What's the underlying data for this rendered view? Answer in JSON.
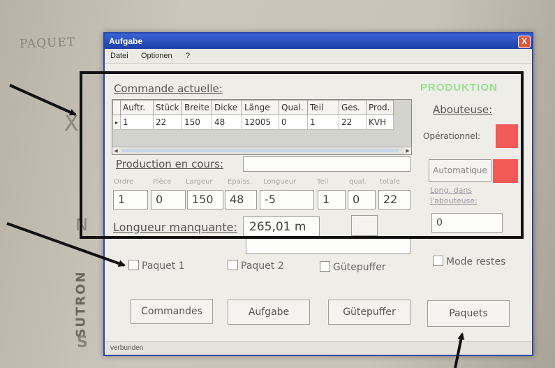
{
  "window": {
    "title": "Aufgabe",
    "close": "X",
    "status": "verbunden"
  },
  "menu": [
    "Datei",
    "Optionen",
    "?"
  ],
  "commande": {
    "title": "Commande actuelle:",
    "columns": [
      "Auftr.",
      "Stück",
      "Breite",
      "Dicke",
      "Länge",
      "Qual.",
      "Teil",
      "Ges.",
      "Prod."
    ],
    "row_marker": "▸",
    "rows": [
      [
        "1",
        "22",
        "150",
        "48",
        "12005",
        "0",
        "1",
        "22",
        "KVH"
      ]
    ]
  },
  "production": {
    "title": "Production en cours:",
    "labels": [
      "Ordre",
      "Pièce",
      "Largeur",
      "Epaiss.",
      "Longueur",
      "Teil",
      "qual.",
      "totale"
    ],
    "values": [
      "1",
      "0",
      "150",
      "48",
      "-5",
      "1",
      "0",
      "22"
    ]
  },
  "longueur_manquante": {
    "label": "Longueur manquante:",
    "value": "265,01 m"
  },
  "abouteuse": {
    "title": "Abouteuse:",
    "operationnel": "Opérationnel:",
    "automatique": "Automatique",
    "long_dans_line1": "Long. dans",
    "long_dans_line2": "l'abouteuse:",
    "long_value": "0",
    "indicator_color": "#f25a58",
    "banner": "PRODUKTION"
  },
  "checkboxes": {
    "paquet1": "Paquet 1",
    "paquet2": "Paquet 2",
    "gutepuffer": "Gütepuffer",
    "mode_restes": "Mode restes"
  },
  "buttons": {
    "commandes": "Commandes",
    "aufgabe": "Aufgabe",
    "gutepuffer": "Gütepuffer",
    "paquets": "Paquets"
  },
  "background": {
    "wall_text": "PAQUET",
    "brand": "SUTRON",
    "mark_x": "X",
    "mark_n": "N",
    "mark_s": "S"
  },
  "colors": {
    "titlebar": "#2a49a8",
    "annotation": "#111111",
    "window_bg": "#eeede8"
  }
}
